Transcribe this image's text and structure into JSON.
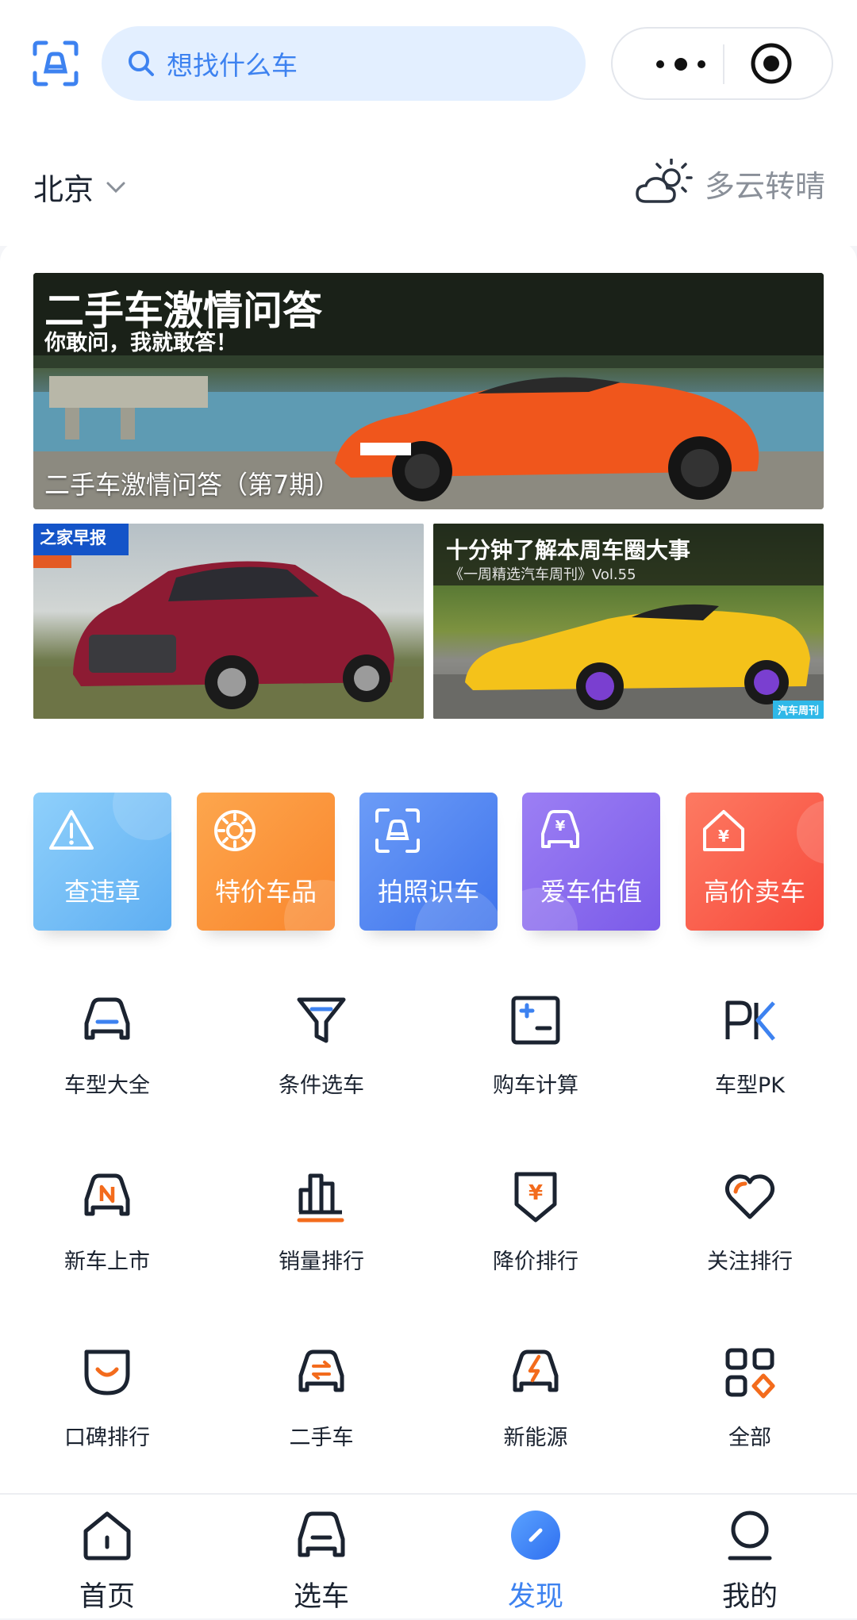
{
  "search": {
    "placeholder": "想找什么车"
  },
  "location": {
    "city": "北京",
    "weather": "多云转晴"
  },
  "banners": {
    "main": {
      "headline": "二手车激情问答",
      "subline": "你敢问，我就敢答！",
      "caption": "二手车激情问答（第7期）"
    },
    "left": {
      "tag": "之家早报"
    },
    "right": {
      "headline": "十分钟了解本周车圈大事",
      "subline": "《一周精选汽车周刊》Vol.55",
      "tag": "汽车周刊"
    }
  },
  "tiles": [
    {
      "label": "查违章",
      "icon": "warning-icon",
      "color": "#76bdf5"
    },
    {
      "label": "特价车品",
      "icon": "gear-icon",
      "color": "#fb9a3c"
    },
    {
      "label": "拍照识车",
      "icon": "camera-scan-icon",
      "color": "#4f86f2"
    },
    {
      "label": "爱车估值",
      "icon": "car-yuan-icon",
      "color": "#8b6bf0"
    },
    {
      "label": "高价卖车",
      "icon": "house-yuan-icon",
      "color": "#fb5a48"
    }
  ],
  "grid": [
    {
      "label": "车型大全",
      "icon": "car-models-icon"
    },
    {
      "label": "条件选车",
      "icon": "filter-icon"
    },
    {
      "label": "购车计算",
      "icon": "calculator-icon"
    },
    {
      "label": "车型PK",
      "icon": "pk-icon"
    },
    {
      "label": "新车上市",
      "icon": "new-car-icon"
    },
    {
      "label": "销量排行",
      "icon": "sales-chart-icon"
    },
    {
      "label": "降价排行",
      "icon": "price-drop-icon"
    },
    {
      "label": "关注排行",
      "icon": "heart-icon"
    },
    {
      "label": "口碑排行",
      "icon": "smile-badge-icon"
    },
    {
      "label": "二手车",
      "icon": "used-car-icon"
    },
    {
      "label": "新能源",
      "icon": "ev-car-icon"
    },
    {
      "label": "全部",
      "icon": "all-apps-icon"
    }
  ],
  "tabs": [
    {
      "label": "首页",
      "icon": "home-icon"
    },
    {
      "label": "选车",
      "icon": "car-icon"
    },
    {
      "label": "发现",
      "icon": "compass-icon",
      "active": true
    },
    {
      "label": "我的",
      "icon": "profile-icon"
    }
  ],
  "colors": {
    "accent": "#3d82f0",
    "text": "#1b2330",
    "orange": "#f36b1c"
  }
}
